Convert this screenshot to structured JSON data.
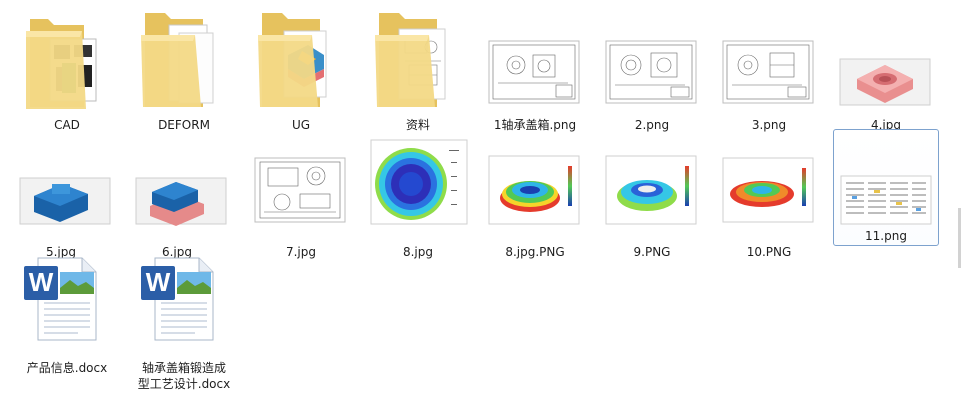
{
  "items": [
    {
      "label": "CAD",
      "type": "folder",
      "preview": "cad-drawing"
    },
    {
      "label": "DEFORM",
      "type": "folder",
      "preview": "blank-sheets"
    },
    {
      "label": "UG",
      "type": "folder",
      "preview": "3d-model"
    },
    {
      "label": "资料",
      "type": "folder",
      "preview": "drawing"
    },
    {
      "label": "1轴承盖箱.png",
      "type": "image",
      "preview": "line-drawing"
    },
    {
      "label": "2.png",
      "type": "image",
      "preview": "line-drawing"
    },
    {
      "label": "3.png",
      "type": "image",
      "preview": "line-drawing"
    },
    {
      "label": "4.jpg",
      "type": "image",
      "preview": "pink-3d-part"
    },
    {
      "label": "5.jpg",
      "type": "image",
      "preview": "blue-3d-part"
    },
    {
      "label": "6.jpg",
      "type": "image",
      "preview": "blue-pink-3d-part"
    },
    {
      "label": "7.jpg",
      "type": "image",
      "preview": "line-drawing"
    },
    {
      "label": "8.jpg",
      "type": "image",
      "preview": "fem-ring-plot"
    },
    {
      "label": "8.jpg.PNG",
      "type": "image",
      "preview": "fem-3d-plot"
    },
    {
      "label": "9.PNG",
      "type": "image",
      "preview": "fem-3d-plot"
    },
    {
      "label": "10.PNG",
      "type": "image",
      "preview": "fem-3d-plot"
    },
    {
      "label": "11.png",
      "type": "image",
      "preview": "table-doc",
      "selected": true
    },
    {
      "label": "产品信息.docx",
      "type": "word",
      "preview": "word-doc"
    },
    {
      "label": "轴承盖箱锻造成型工艺设计.docx",
      "label_line1": "轴承盖箱锻造成",
      "label_line2": "型工艺设计.docx",
      "type": "word",
      "preview": "word-doc"
    }
  ],
  "colors": {
    "folder": "#f0d27a",
    "folder_dark": "#d8b455",
    "selection_border": "#7da2ce",
    "word_blue": "#2b5ea7"
  },
  "icons": {
    "folder": "folder-icon",
    "word": "word-document-icon"
  }
}
